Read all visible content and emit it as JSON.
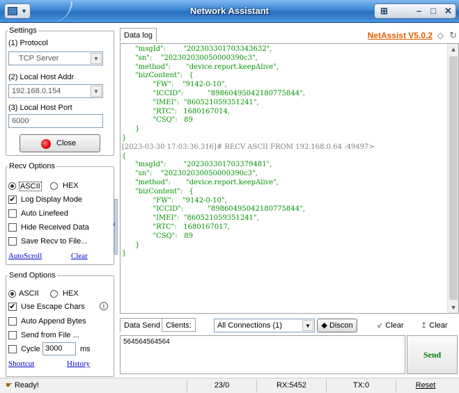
{
  "window": {
    "title": "Network Assistant"
  },
  "settings": {
    "legend": "Settings",
    "protocol_label": "(1) Protocol",
    "protocol_value": "TCP Server",
    "host_addr_label": "(2) Local Host Addr",
    "host_addr_value": "192.168.0.154",
    "host_port_label": "(3) Local Host Port",
    "host_port_value": "6000",
    "close_button": "Close"
  },
  "recv_options": {
    "legend": "Recv Options",
    "ascii_label": "ASCII",
    "hex_label": "HEX",
    "mode_selected": "ASCII",
    "log_display_mode": {
      "label": "Log Display Mode",
      "checked": true
    },
    "auto_linefeed": {
      "label": "Auto Linefeed",
      "checked": false
    },
    "hide_received": {
      "label": "Hide Received Data",
      "checked": false
    },
    "save_to_file": {
      "label": "Save Recv to File...",
      "checked": false
    },
    "autoscroll_link": "AutoScroll",
    "clear_link": "Clear"
  },
  "send_options": {
    "legend": "Send Options",
    "ascii_label": "ASCII",
    "hex_label": "HEX",
    "mode_selected": "ASCII",
    "use_escape": {
      "label": "Use Escape Chars",
      "checked": true
    },
    "auto_append": {
      "label": "Auto Append Bytes",
      "checked": false
    },
    "send_from_file": {
      "label": "Send from File ...",
      "checked": false
    },
    "cycle": {
      "label": "Cycle",
      "checked": false,
      "value": "3000",
      "unit": "ms"
    },
    "shortcut_link": "Shortcut",
    "history_link": "History"
  },
  "log": {
    "tab_label": "Data log",
    "brand": "NetAssist V5.0.2",
    "lines": [
      "      \"msgId\":        \"202303301703343632\",",
      "      \"sn\":    \"202302030050000390c3\",",
      "      \"method\":       \"device.report.keepAlive\",",
      "      \"bizContent\":   {",
      "              \"FW\":    \"9142-0-10\",",
      "              \"ICCID\":           \"89860495042180775844\",",
      "              \"IMEI\":  \"860521059351241\",",
      "              \"RTC\":   1680167014,",
      "              \"CSQ\":   89",
      "      }",
      "}",
      "[2023-03-30 17:03:36.316]# RECV ASCII FROM 192.168.0.64 :49497>",
      "{",
      "      \"msgId\":        \"202303301703379481\",",
      "      \"sn\":    \"202302030050000390c3\",",
      "      \"method\":       \"device.report.keepAlive\",",
      "      \"bizContent\":   {",
      "              \"FW\":    \"9142-0-10\",",
      "              \"ICCID\":           \"89860495042180775844\",",
      "              \"IMEI\":  \"860521059351241\",",
      "              \"RTC\":   1680167017,",
      "              \"CSQ\":   89",
      "      }",
      "}"
    ]
  },
  "send": {
    "tab_label": "Data Send",
    "clients_label": "Clients:",
    "connections_value": "All Connections (1)",
    "disconnect_label": "Discon",
    "clear1_label": "Clear",
    "clear2_label": "Clear",
    "input_value": "564564564564",
    "send_button": "Send"
  },
  "status": {
    "ready": "Ready!",
    "counter": "23/0",
    "rx": "RX:5452",
    "tx": "TX:0",
    "reset": "Reset"
  }
}
